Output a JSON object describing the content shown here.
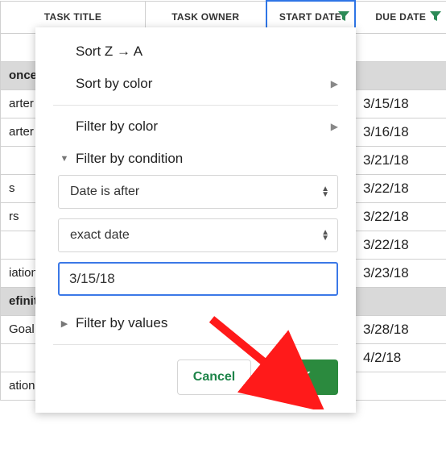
{
  "columns": {
    "task_title": "TASK TITLE",
    "task_owner": "TASK OWNER",
    "start_date": "START DATE",
    "due_date": "DUE DATE"
  },
  "rows": [
    {
      "type": "spacer",
      "title": "",
      "due": ""
    },
    {
      "type": "section",
      "title": "oncep",
      "due": ""
    },
    {
      "type": "data",
      "title": "arter",
      "due": "3/15/18"
    },
    {
      "type": "data",
      "title": "arter P",
      "due": "3/16/18"
    },
    {
      "type": "data",
      "title": "",
      "due": "3/21/18"
    },
    {
      "type": "data",
      "title": "s",
      "due": "3/22/18"
    },
    {
      "type": "data",
      "title": "rs",
      "due": "3/22/18"
    },
    {
      "type": "data",
      "title": "",
      "due": "3/22/18"
    },
    {
      "type": "data",
      "title": "iation",
      "due": "3/23/18"
    },
    {
      "type": "section",
      "title": "efiniti",
      "due": ""
    },
    {
      "type": "data",
      "title": "Goal S",
      "due": "3/28/18"
    },
    {
      "type": "data",
      "title": "",
      "due": "4/2/18"
    },
    {
      "type": "data",
      "title": "ation",
      "due": ""
    }
  ],
  "menu": {
    "sort_za": "Sort Z → A",
    "sort_by_color": "Sort by color",
    "filter_by_color": "Filter by color",
    "filter_by_condition": "Filter by condition",
    "filter_by_values": "Filter by values",
    "condition_type": "Date is after",
    "condition_mode": "exact date",
    "date_value": "3/15/18",
    "cancel": "Cancel",
    "ok": "OK"
  }
}
